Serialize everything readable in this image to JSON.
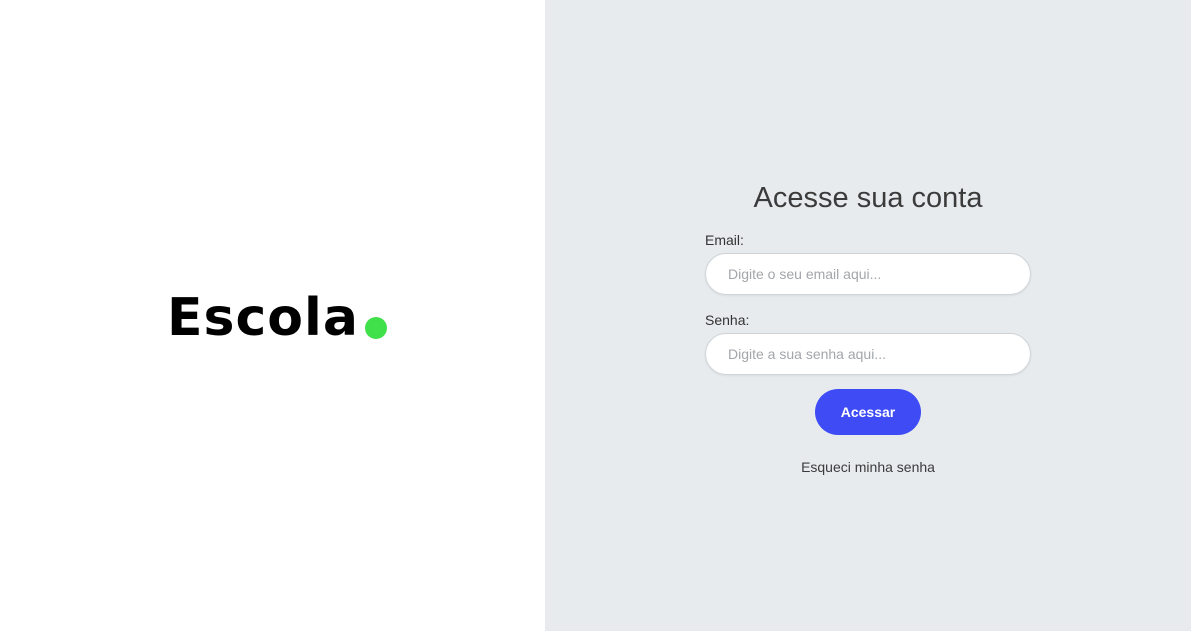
{
  "brand": {
    "logo_text": "Escola",
    "dot_color": "#3fe04a"
  },
  "login": {
    "title": "Acesse sua conta",
    "email_label": "Email:",
    "email_placeholder": "Digite o seu email aqui...",
    "password_label": "Senha:",
    "password_placeholder": "Digite a sua senha aqui...",
    "submit_label": "Acessar",
    "submit_color": "#3f4cf6",
    "forgot_link": "Esqueci minha senha"
  },
  "colors": {
    "left_background": "#ffffff",
    "right_background": "#e7ebed"
  }
}
